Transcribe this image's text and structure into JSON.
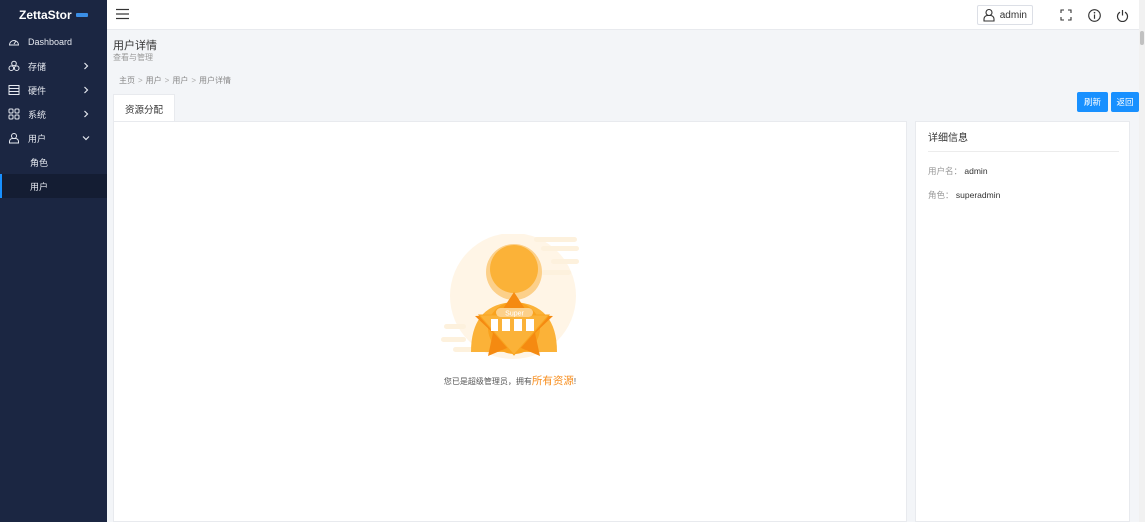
{
  "brand": {
    "name": "ZettaStor"
  },
  "sidebar": {
    "items": [
      {
        "label": "Dashboard",
        "icon": "dashboard-icon"
      },
      {
        "label": "存储",
        "icon": "storage-icon"
      },
      {
        "label": "硬件",
        "icon": "hardware-icon"
      },
      {
        "label": "系统",
        "icon": "system-icon"
      },
      {
        "label": "用户",
        "icon": "user-icon"
      }
    ],
    "sub_items": [
      {
        "label": "角色"
      },
      {
        "label": "用户",
        "active": true
      }
    ]
  },
  "header": {
    "username": "admin"
  },
  "page": {
    "title": "用户详情",
    "subtitle": "查看与管理",
    "breadcrumb": [
      "主页",
      "用户",
      "用户",
      "用户详情"
    ]
  },
  "tabs": {
    "active": "资源分配"
  },
  "buttons": {
    "refresh": "刷新",
    "back": "返回"
  },
  "main": {
    "badge_text": "Super",
    "message_prefix": "您已是超级管理员，拥有",
    "message_highlight": "所有资源",
    "message_suffix": "!"
  },
  "detail": {
    "title": "详细信息",
    "username_label": "用户名：",
    "username_value": "admin",
    "role_label": "角色：",
    "role_value": "superadmin"
  },
  "colors": {
    "sidebar_bg": "#1b2642",
    "accent": "#1890ff",
    "highlight": "#f78e1e"
  }
}
